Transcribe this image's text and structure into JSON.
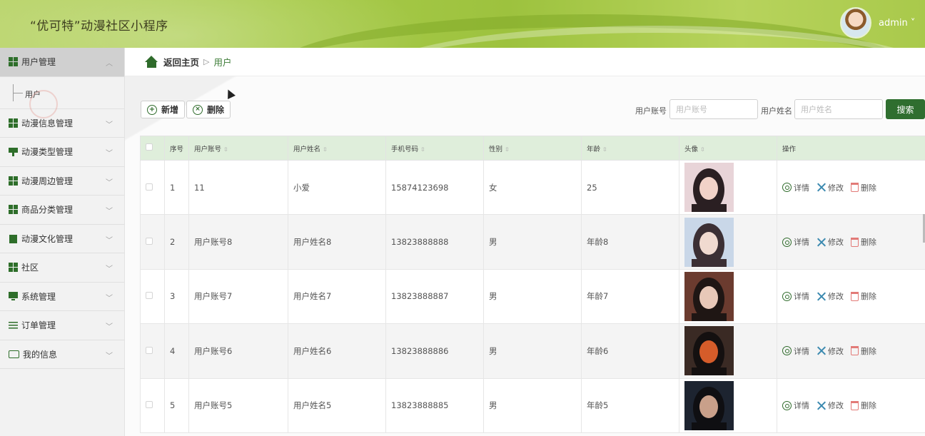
{
  "app": {
    "title": "“优可特”动漫社区小程序",
    "user": "admin ˅"
  },
  "sidebar": {
    "items": [
      {
        "label": "用户管理",
        "icon": "grid-icon",
        "active": true,
        "sub": [
          {
            "label": "用户"
          }
        ]
      },
      {
        "label": "动漫信息管理",
        "icon": "grid-icon"
      },
      {
        "label": "动漫类型管理",
        "icon": "flag-icon"
      },
      {
        "label": "动漫周边管理",
        "icon": "grid-icon"
      },
      {
        "label": "商品分类管理",
        "icon": "grid-icon"
      },
      {
        "label": "动漫文化管理",
        "icon": "clipboard-icon"
      },
      {
        "label": "社区",
        "icon": "grid-icon"
      },
      {
        "label": "系统管理",
        "icon": "monitor-icon"
      },
      {
        "label": "订单管理",
        "icon": "sliders-icon"
      },
      {
        "label": "我的信息",
        "icon": "card-icon"
      }
    ]
  },
  "breadcrumb": {
    "home": "返回主页",
    "sep": "▷",
    "current": "用户"
  },
  "toolbar": {
    "add_label": "新增",
    "delete_label": "删除"
  },
  "search": {
    "account_label": "用户账号",
    "account_placeholder": "用户账号",
    "name_label": "用户姓名",
    "name_placeholder": "用户姓名",
    "button": "搜索"
  },
  "table": {
    "headers": [
      "序号",
      "用户账号",
      "用户姓名",
      "手机号码",
      "性别",
      "年龄",
      "头像",
      "操作"
    ],
    "rows": [
      {
        "no": "1",
        "account": "11",
        "name": "小爱",
        "phone": "15874123698",
        "gender": "女",
        "age": "25"
      },
      {
        "no": "2",
        "account": "用户账号8",
        "name": "用户姓名8",
        "phone": "13823888888",
        "gender": "男",
        "age": "年龄8"
      },
      {
        "no": "3",
        "account": "用户账号7",
        "name": "用户姓名7",
        "phone": "13823888887",
        "gender": "男",
        "age": "年龄7"
      },
      {
        "no": "4",
        "account": "用户账号6",
        "name": "用户姓名6",
        "phone": "13823888886",
        "gender": "男",
        "age": "年龄6"
      },
      {
        "no": "5",
        "account": "用户账号5",
        "name": "用户姓名5",
        "phone": "13823888885",
        "gender": "男",
        "age": "年龄5"
      }
    ],
    "actions": {
      "detail": "详情",
      "edit": "修改",
      "delete": "删除"
    }
  },
  "colors": {
    "brand": "#2f6e2f",
    "header": "#a8cb4a",
    "table_head": "#dfeedb"
  }
}
